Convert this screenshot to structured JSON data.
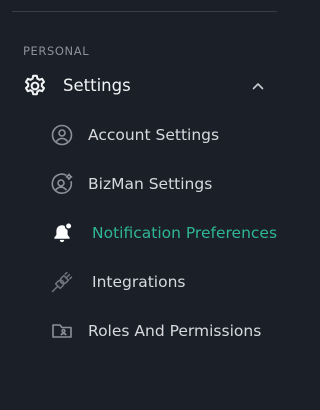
{
  "section": {
    "label": "PERSONAL"
  },
  "group": {
    "label": "Settings",
    "icon": "gear-icon",
    "expanded": true,
    "chevron": "chevron-up-icon"
  },
  "items": [
    {
      "label": "Account Settings",
      "icon": "user-circle-icon",
      "active": false
    },
    {
      "label": "BizMan Settings",
      "icon": "user-gear-icon",
      "active": false
    },
    {
      "label": "Notification Preferences",
      "icon": "bell-icon",
      "active": true
    },
    {
      "label": "Integrations",
      "icon": "plug-icon",
      "active": false
    },
    {
      "label": "Roles And Permissions",
      "icon": "folder-user-icon",
      "active": false
    }
  ],
  "colors": {
    "background": "#1b1f27",
    "text": "#d7d9de",
    "active": "#2fb597",
    "muted_icon": "#8b9099"
  }
}
